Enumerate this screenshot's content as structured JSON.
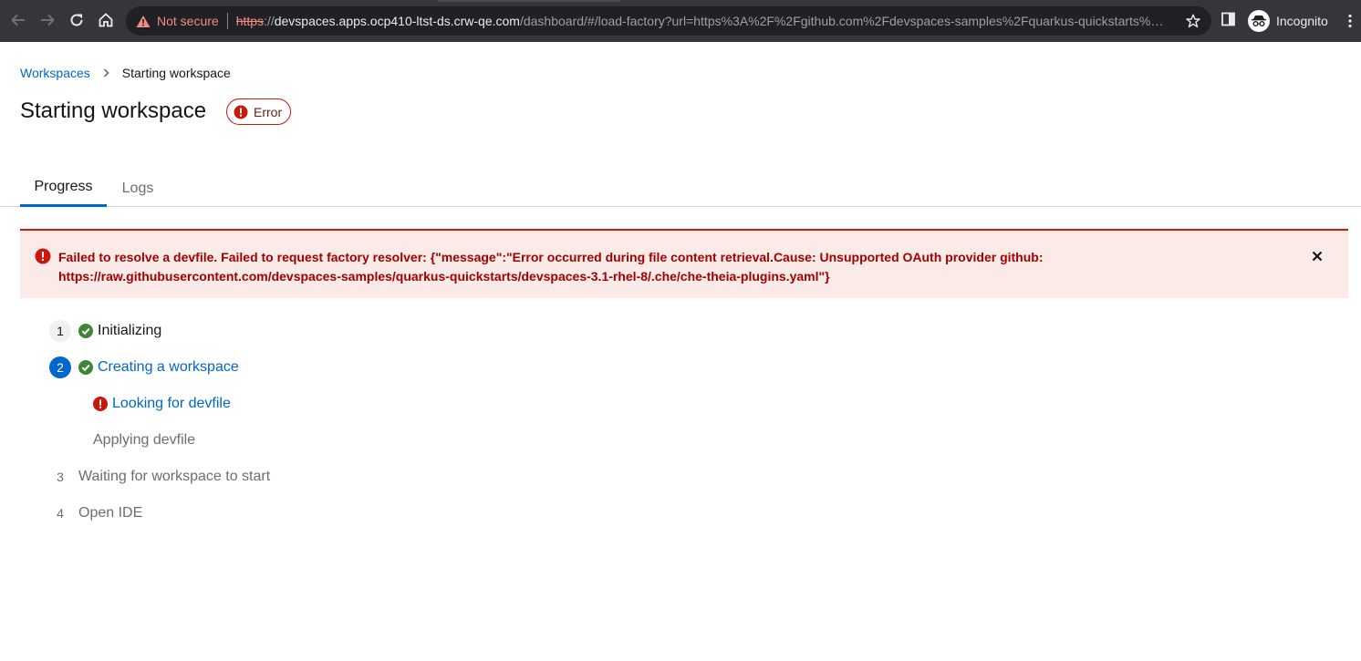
{
  "browser": {
    "security_label": "Not secure",
    "url_scheme": "https",
    "url_separator": "://",
    "url_host": "devspaces.apps.ocp410-ltst-ds.crw-qe.com",
    "url_rest": "/dashboard/#/load-factory?url=https%3A%2F%2Fgithub.com%2Fdevspaces-samples%2Fquarkus-quickstarts%…",
    "profile_label": "Incognito"
  },
  "breadcrumb": {
    "root": "Workspaces",
    "current": "Starting workspace"
  },
  "header": {
    "title": "Starting workspace",
    "status": "Error",
    "status_color": "#c9190b"
  },
  "tabs": [
    {
      "label": "Progress",
      "active": true
    },
    {
      "label": "Logs",
      "active": false
    }
  ],
  "alert": {
    "line1": "Failed to resolve a devfile. Failed to request factory resolver: {\"message\":\"Error occurred during file content retrieval.Cause: Unsupported OAuth provider github:",
    "line2": "https://raw.githubusercontent.com/devspaces-samples/quarkus-quickstarts/devspaces-3.1-rhel-8/.che/che-theia-plugins.yaml\"}",
    "color": "#a30000"
  },
  "steps": [
    {
      "number": "1",
      "label": "Initializing",
      "state": "done"
    },
    {
      "number": "2",
      "label": "Creating a workspace",
      "state": "current"
    },
    {
      "label": "Looking for devfile",
      "state": "error",
      "substep": true
    },
    {
      "label": "Applying devfile",
      "state": "pending",
      "substep": true
    },
    {
      "number": "3",
      "label": "Waiting for workspace to start",
      "state": "pending"
    },
    {
      "number": "4",
      "label": "Open IDE",
      "state": "pending"
    }
  ],
  "colors": {
    "accent": "#0066cc",
    "success": "#3e8635",
    "danger": "#c9190b"
  }
}
